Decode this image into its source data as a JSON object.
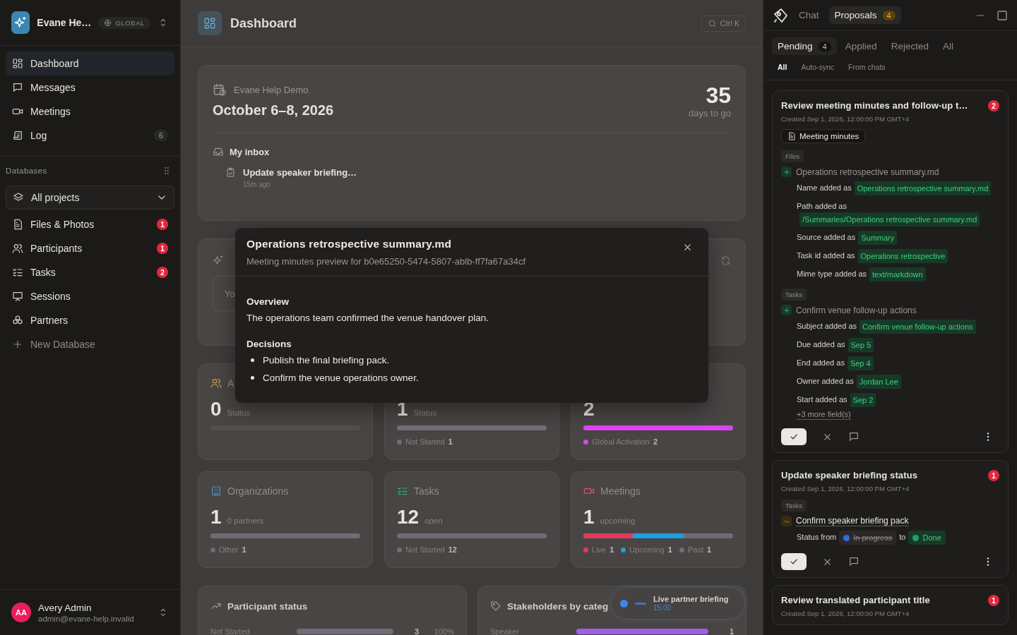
{
  "sidebar": {
    "workspace": {
      "name": "Evane He…",
      "scope": "GLOBAL"
    },
    "nav": [
      {
        "label": "Dashboard",
        "kind": "dashboard",
        "selected": true
      },
      {
        "label": "Messages",
        "kind": "messages",
        "selected": false
      },
      {
        "label": "Meetings",
        "kind": "meetings",
        "selected": false
      },
      {
        "label": "Log",
        "kind": "log",
        "selected": false,
        "count": "6"
      }
    ],
    "databases_label": "Databases",
    "project_select": {
      "value": "All projects"
    },
    "databases": [
      {
        "label": "Files & Photos",
        "kind": "files",
        "count": "1"
      },
      {
        "label": "Participants",
        "kind": "participants",
        "count": "1"
      },
      {
        "label": "Tasks",
        "kind": "tasks",
        "count": "2"
      },
      {
        "label": "Sessions",
        "kind": "sessions"
      },
      {
        "label": "Partners",
        "kind": "partners"
      }
    ],
    "new_database": "New Database",
    "user": {
      "initials": "AA",
      "name": "Avery Admin",
      "email": "admin@evane-help.invalid"
    }
  },
  "main": {
    "title": "Dashboard",
    "search_shortcut": "Ctrl K",
    "event": {
      "name": "Evane Help Demo",
      "dates": "October 6–8, 2026",
      "countdown": "35",
      "countdown_label": "days to go",
      "inbox_title": "My inbox",
      "inbox_items": [
        {
          "title": "Update speaker briefing…",
          "time": "15m ago"
        }
      ]
    },
    "covered_card": {
      "field": "Yo"
    },
    "stat_cards": [
      {
        "kind": "participants",
        "title": "A",
        "value": "0",
        "unit": "Status"
      },
      {
        "value": "1",
        "unit": "Status",
        "segments": [
          {
            "color": "#6e6c75",
            "level": 1
          }
        ],
        "legend": [
          {
            "label": "Not Started",
            "count": "1",
            "color": "#6e6c75"
          }
        ]
      },
      {
        "value": "2",
        "segments": [
          {
            "color": "#d946ef",
            "level": 1
          }
        ],
        "legend": [
          {
            "label": "Global Activation",
            "count": "2",
            "color": "#d946ef"
          }
        ]
      },
      {
        "kind": "organizations",
        "title": "Organizations",
        "value": "1",
        "unit": "0 partners",
        "segments": [
          {
            "color": "#6e6c75",
            "level": 1
          }
        ],
        "legend": [
          {
            "label": "Other",
            "count": "1",
            "color": "#6e6c75"
          }
        ]
      },
      {
        "kind": "tasks",
        "title": "Tasks",
        "value": "12",
        "unit": "open",
        "segments": [
          {
            "color": "#6e6c75",
            "level": 1
          }
        ],
        "legend": [
          {
            "label": "Not Started",
            "count": "12",
            "color": "#6e6c75"
          }
        ]
      },
      {
        "kind": "meetings",
        "title": "Meetings",
        "value": "1",
        "unit": "upcoming",
        "segments": [
          {
            "color": "#e23b5a",
            "level": 0.33
          },
          {
            "color": "#1e9fe0",
            "level": 0.67
          },
          {
            "color": "#6e6c75",
            "level": 1
          }
        ],
        "legend": [
          {
            "label": "Live",
            "count": "1",
            "color": "#e23b5a"
          },
          {
            "label": "Upcoming",
            "count": "1",
            "color": "#1e9fe0"
          },
          {
            "label": "Past",
            "count": "1",
            "color": "#6e6c75"
          }
        ]
      }
    ],
    "panels": [
      {
        "kind": "trend",
        "title": "Participant status",
        "rows": [
          {
            "label": "Not Started",
            "level": 1,
            "count": "3",
            "percent": "100%",
            "color": "#6e6c75"
          }
        ]
      },
      {
        "kind": "tag",
        "title": "Stakeholders by categ",
        "rows": [
          {
            "label": "Speaker",
            "level": 1,
            "count": "1",
            "color": "#a35ee8"
          }
        ]
      }
    ],
    "live_pill": {
      "title": "Live partner briefing",
      "time": "15:00"
    }
  },
  "modal": {
    "title": "Operations retrospective summary.md",
    "subtitle": "Meeting minutes preview for b0e65250-5474-5807-ablb-ff7fa67a34cf",
    "sections": [
      {
        "heading": "Overview",
        "paragraph": "The operations team confirmed the venue handover plan."
      },
      {
        "heading": "Decisions",
        "bullets": [
          "Publish the final briefing pack.",
          "Confirm the venue operations owner."
        ]
      }
    ]
  },
  "assistant": {
    "tabs": [
      {
        "label": "Chat",
        "selected": false
      },
      {
        "label": "Proposals",
        "selected": true,
        "count": "4"
      }
    ],
    "status_tabs": [
      {
        "label": "Pending",
        "selected": true,
        "count": "4"
      },
      {
        "label": "Applied",
        "selected": false
      },
      {
        "label": "Rejected",
        "selected": false
      },
      {
        "label": "All",
        "selected": false
      }
    ],
    "source_filters": [
      {
        "label": "All",
        "selected": true
      },
      {
        "label": "Auto-sync",
        "selected": false
      },
      {
        "label": "From chats",
        "selected": false
      }
    ],
    "proposals": [
      {
        "title": "Review meeting minutes and follow-up t…",
        "count": "2",
        "created": "Created Sep 1, 2026, 12:00:00 PM GMT+4",
        "attachment": "Meeting minutes",
        "groups": [
          {
            "section": "Files",
            "kind": "add",
            "name": "Operations retrospective summary.md",
            "fields": [
              {
                "label": "Name added as",
                "value": "Operations retrospective summary.md"
              },
              {
                "label": "Path added as",
                "value": "/Summaries/Operations retrospective summary.md"
              },
              {
                "label": "Source added as",
                "value": "Summary"
              },
              {
                "label": "Task id added as",
                "value": "Operations retrospective"
              },
              {
                "label": "Mime type added as",
                "value": "text/markdown"
              }
            ]
          },
          {
            "section": "Tasks",
            "kind": "add",
            "name": "Confirm venue follow-up actions",
            "fields": [
              {
                "label": "Subject added as",
                "value": "Confirm venue follow-up actions"
              },
              {
                "label": "Due added as",
                "value": "Sep 5"
              },
              {
                "label": "End added as",
                "value": "Sep 4"
              },
              {
                "label": "Owner added as",
                "value": "Jordan Lee"
              },
              {
                "label": "Start added as",
                "value": "Sep 2"
              }
            ],
            "more": "+3 more field(s)"
          }
        ]
      },
      {
        "title": "Update speaker briefing status",
        "count": "1",
        "created": "Created Sep 1, 2026, 12:00:00 PM GMT+4",
        "groups": [
          {
            "section": "Tasks",
            "kind": "change",
            "name": "Confirm speaker briefing pack",
            "fields": [
              {
                "kind": "status",
                "label": "Status from",
                "from": {
                  "text": "In progress",
                  "color": "#2b6fe0"
                },
                "joiner": "to",
                "to": {
                  "text": "Done",
                  "color": "#22a06b"
                }
              }
            ]
          }
        ]
      },
      {
        "title": "Review translated participant title",
        "count": "1",
        "created": "Created Sep 1, 2026, 12:00:00 PM GMT+4"
      }
    ]
  }
}
